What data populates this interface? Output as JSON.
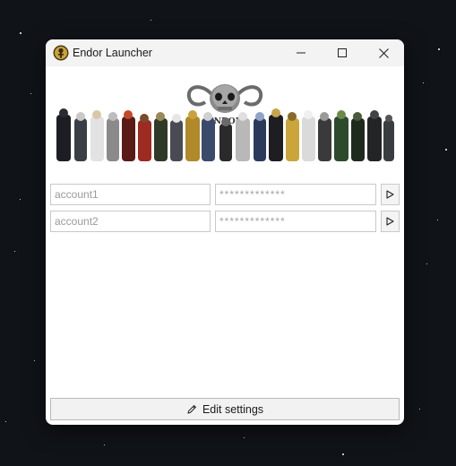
{
  "window": {
    "title": "Endor Launcher",
    "icon": "endor-emblem-icon",
    "controls": [
      "minimize-icon",
      "maximize-icon",
      "close-icon"
    ]
  },
  "banner": {
    "logo_text": "ENDOR",
    "description": "skull-logo-with-character-lineup"
  },
  "accounts": [
    {
      "account_placeholder": "account1",
      "password_placeholder": "*************",
      "launch_icon": "play-icon"
    },
    {
      "account_placeholder": "account2",
      "password_placeholder": "*************",
      "launch_icon": "play-icon"
    }
  ],
  "footer": {
    "edit_label": "Edit settings",
    "edit_icon": "pencil-icon"
  },
  "colors": {
    "desktop": "#101318",
    "window_bg": "#ffffff",
    "titlebar_bg": "#f3f3f3",
    "field_border": "#c9c9c9"
  }
}
